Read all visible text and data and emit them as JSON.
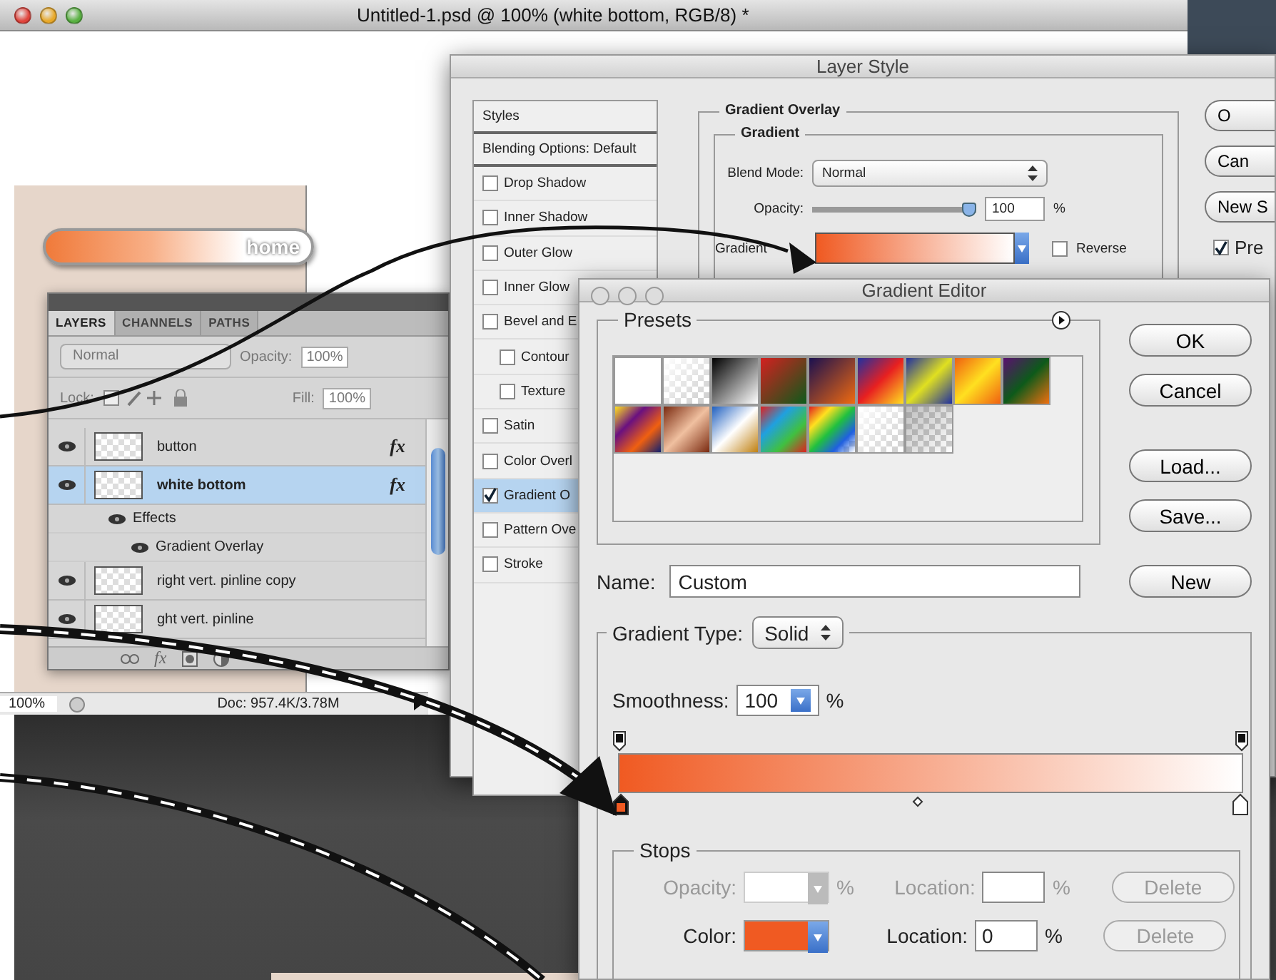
{
  "document": {
    "title": "Untitled-1.psd @ 100% (white bottom, RGB/8) *",
    "canvas_button": "home",
    "status_bar": {
      "zoom": "100%",
      "doc_info": "Doc: 957.4K/3.78M"
    }
  },
  "layers_panel": {
    "tabs": [
      {
        "label": "LAYERS",
        "selected": true
      },
      {
        "label": "CHANNELS",
        "selected": false
      },
      {
        "label": "PATHS",
        "selected": false
      }
    ],
    "blend_mode": "Normal",
    "opacity_label": "Opacity:",
    "opacity": "100%",
    "lock_label": "Lock:",
    "fill_label": "Fill:",
    "fill": "100%",
    "layers": [
      {
        "name": "button",
        "fx": "fx",
        "visible": true,
        "selected": false
      },
      {
        "name": "white bottom",
        "fx": "fx",
        "visible": true,
        "selected": true,
        "children": [
          {
            "name": "Effects",
            "visible": true,
            "children": [
              {
                "name": "Gradient Overlay",
                "visible": true
              }
            ]
          }
        ]
      },
      {
        "name": "right vert. pinline copy",
        "visible": true,
        "selected": false
      },
      {
        "name": "ght vert. pinline",
        "visible": true,
        "selected": false
      }
    ],
    "footer_fx": "fx"
  },
  "layer_style": {
    "title": "Layer Style",
    "styles": [
      {
        "label": "Styles",
        "kind": "header"
      },
      {
        "label": "Blending Options: Default",
        "kind": "header"
      },
      {
        "label": "Drop Shadow",
        "kind": "check",
        "checked": false,
        "selected": false
      },
      {
        "label": "Inner Shadow",
        "kind": "check",
        "checked": false,
        "selected": false
      },
      {
        "label": "Outer Glow",
        "kind": "check",
        "checked": false,
        "selected": false
      },
      {
        "label": "Inner Glow",
        "kind": "check",
        "checked": false,
        "selected": false
      },
      {
        "label": "Bevel and E",
        "kind": "check",
        "checked": false,
        "selected": false,
        "children": [
          {
            "label": "Contour",
            "kind": "check",
            "checked": false,
            "selected": false
          },
          {
            "label": "Texture",
            "kind": "check",
            "checked": false,
            "selected": false
          }
        ]
      },
      {
        "label": "Satin",
        "kind": "check",
        "checked": false,
        "selected": false
      },
      {
        "label": "Color Overl",
        "kind": "check",
        "checked": false,
        "selected": false
      },
      {
        "label": "Gradient O",
        "kind": "check",
        "checked": true,
        "selected": true
      },
      {
        "label": "Pattern Ove",
        "kind": "check",
        "checked": false,
        "selected": false
      },
      {
        "label": "Stroke",
        "kind": "check",
        "checked": false,
        "selected": false
      }
    ],
    "overlay": {
      "title": "Gradient Overlay",
      "group": "Gradient",
      "blend_mode_label": "Blend Mode:",
      "blend_mode": "Normal",
      "opacity_label": "Opacity:",
      "level": 1,
      "opacity": "100",
      "percent": "%",
      "gradient_label": "Gradient",
      "reverse_label": "Reverse",
      "reverse": false
    },
    "buttons": [
      "O",
      "Can",
      "New S"
    ],
    "preview": {
      "label": "Pre",
      "checked": true
    }
  },
  "gradient_editor": {
    "title": "Gradient Editor",
    "presets_label": "Presets",
    "buttons": [
      "OK",
      "Cancel",
      "Load...",
      "Save..."
    ],
    "name_label": "Name:",
    "name": "Custom",
    "new_button": "New",
    "type_label": "Gradient Type:",
    "type": "Solid",
    "smoothness_label": "Smoothness:",
    "smoothness": "100",
    "percent": "%",
    "color_stops": [
      {
        "kind": "start",
        "selected": true
      },
      {
        "kind": "end",
        "selected": false
      }
    ],
    "stops": {
      "title": "Stops",
      "opacity_label": "Opacity:",
      "opacity_disabled": true,
      "percent": "%",
      "location_label": "Location:",
      "delete": "Delete",
      "color_label": "Color:",
      "color_location": "0",
      "color_percent": "%",
      "color_location_label": "Location:",
      "color_delete": "Delete"
    }
  }
}
